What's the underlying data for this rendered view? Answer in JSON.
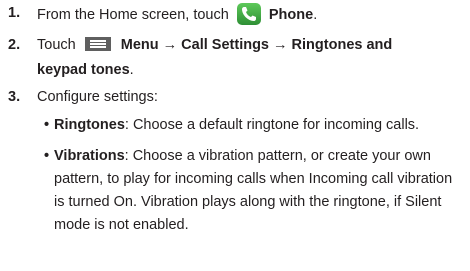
{
  "steps": [
    {
      "number": "1.",
      "text_before": "From the Home screen, touch",
      "icon": "phone-app-icon",
      "label": "Phone",
      "text_after": "."
    },
    {
      "number": "2.",
      "text_before": "Touch",
      "icon": "menu-icon",
      "path_line1": "Menu → Call Settings → Ringtones and",
      "path_line2": "keypad tones",
      "text_after": "."
    },
    {
      "number": "3.",
      "text": "Configure settings:"
    }
  ],
  "settings": [
    {
      "name": "Ringtones",
      "desc": ": Choose a default ringtone for incoming calls."
    },
    {
      "name": "Vibrations",
      "desc_line1": ": Choose a vibration pattern, or create your own",
      "desc_line2": "pattern, to play for incoming calls when Incoming call vibration",
      "desc_line3": "is turned On. Vibration plays along with the ringtone, if Silent",
      "desc_line4": "mode is not enabled."
    }
  ],
  "bullet_glyph": "•",
  "colors": {
    "text": "#231f20",
    "phone_icon": "#3fae45",
    "menu_icon": "#5f5f5f"
  }
}
